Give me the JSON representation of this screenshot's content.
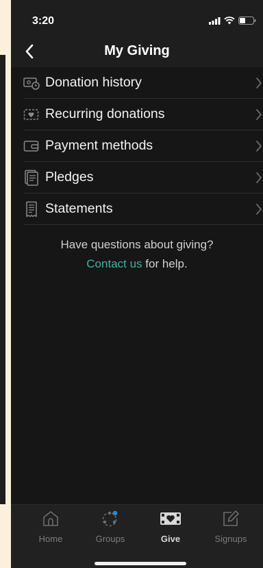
{
  "status_bar": {
    "time": "3:20"
  },
  "nav": {
    "title": "My Giving"
  },
  "menu": {
    "items": [
      {
        "label": "Donation history",
        "icon": "history-icon"
      },
      {
        "label": "Recurring donations",
        "icon": "recurring-icon"
      },
      {
        "label": "Payment methods",
        "icon": "wallet-icon"
      },
      {
        "label": "Pledges",
        "icon": "pledge-icon"
      },
      {
        "label": "Statements",
        "icon": "receipt-icon"
      }
    ]
  },
  "help": {
    "line1": "Have questions about giving?",
    "link": "Contact us",
    "line2_rest": " for help."
  },
  "tab_bar": {
    "tabs": [
      {
        "label": "Home",
        "icon": "home-icon",
        "active": false
      },
      {
        "label": "Groups",
        "icon": "groups-icon",
        "active": false
      },
      {
        "label": "Give",
        "icon": "give-icon",
        "active": true
      },
      {
        "label": "Signups",
        "icon": "signup-icon",
        "active": false
      }
    ]
  },
  "colors": {
    "background": "#161616",
    "bar": "#1e1e1e",
    "accent_link": "#3bb3a0",
    "notification_dot": "#1e88e5"
  }
}
